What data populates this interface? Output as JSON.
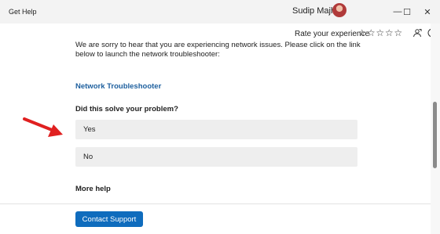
{
  "window": {
    "title": "Get Help",
    "user_name": "Sudip Majhi",
    "controls": {
      "minimize": "—",
      "maximize": "☐",
      "close": "✕"
    }
  },
  "toolbar": {
    "rate_label": "Rate your experience",
    "stars": [
      "☆",
      "☆",
      "☆",
      "☆",
      "☆"
    ],
    "share_icon": "share-icon",
    "info_icon": "info-icon"
  },
  "content": {
    "intro": "We are sorry to hear that you are experiencing network issues. Please click on the link below to launch the network troubleshooter:",
    "link": "Network Troubleshooter",
    "question": "Did this solve your problem?",
    "options": [
      "Yes",
      "No"
    ],
    "more_help": "More help"
  },
  "footer": {
    "contact_button": "Contact Support"
  },
  "colors": {
    "accent": "#0f6cbd",
    "link": "#1d5f9e",
    "arrow": "#e02020"
  }
}
